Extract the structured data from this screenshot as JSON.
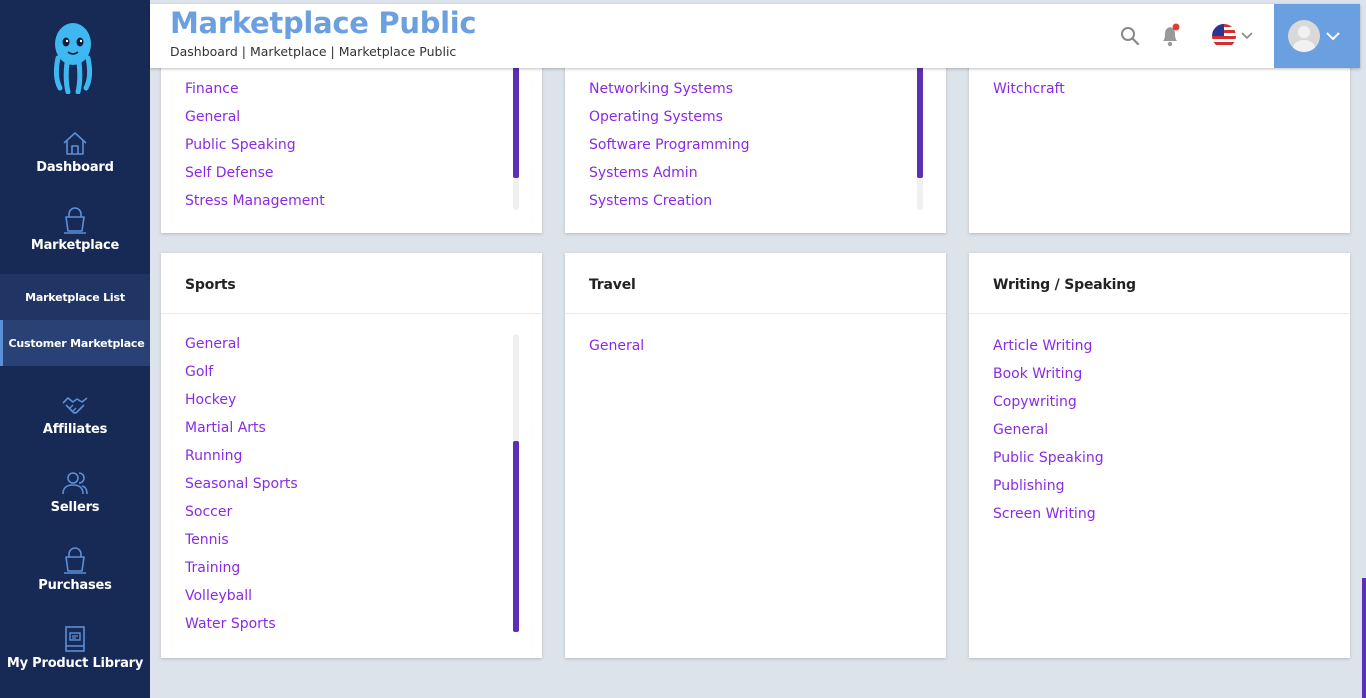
{
  "header": {
    "title": "Marketplace Public",
    "breadcrumb": "Dashboard | Marketplace | Marketplace Public",
    "icons": [
      "search-icon",
      "bell-icon",
      "us-flag-icon",
      "chevron-down-icon",
      "avatar",
      "chevron-down-icon"
    ]
  },
  "sidebar": {
    "items": [
      {
        "label": "Dashboard",
        "icon": "home-icon"
      },
      {
        "label": "Marketplace",
        "icon": "bag-icon"
      },
      {
        "label": "Affiliates",
        "icon": "handshake-icon"
      },
      {
        "label": "Sellers",
        "icon": "users-icon"
      },
      {
        "label": "Purchases",
        "icon": "bag-icon"
      },
      {
        "label": "My Product Library",
        "icon": "book-icon"
      }
    ],
    "submenu": [
      {
        "label": "Marketplace List",
        "active": false
      },
      {
        "label": "Customer Marketplace",
        "active": true
      }
    ]
  },
  "cards_top": [
    {
      "items": [
        "Finance",
        "General",
        "Public Speaking",
        "Self Defense",
        "Stress Management"
      ]
    },
    {
      "items": [
        "Networking Systems",
        "Operating Systems",
        "Software Programming",
        "Systems Admin",
        "Systems Creation"
      ]
    },
    {
      "items": [
        "Witchcraft"
      ]
    }
  ],
  "cards_bottom": [
    {
      "title": "Sports",
      "items": [
        "General",
        "Golf",
        "Hockey",
        "Martial Arts",
        "Running",
        "Seasonal Sports",
        "Soccer",
        "Tennis",
        "Training",
        "Volleyball",
        "Water Sports"
      ]
    },
    {
      "title": "Travel",
      "items": [
        "General"
      ]
    },
    {
      "title": "Writing / Speaking",
      "items": [
        "Article Writing",
        "Book Writing",
        "Copywriting",
        "General",
        "Public Speaking",
        "Publishing",
        "Screen Writing"
      ]
    }
  ],
  "colors": {
    "sidebar": "#172a55",
    "accent": "#6a9fe0",
    "link": "#8a2be2",
    "scrollbar": "#5d2fb4",
    "notification_dot": "#e53935"
  }
}
